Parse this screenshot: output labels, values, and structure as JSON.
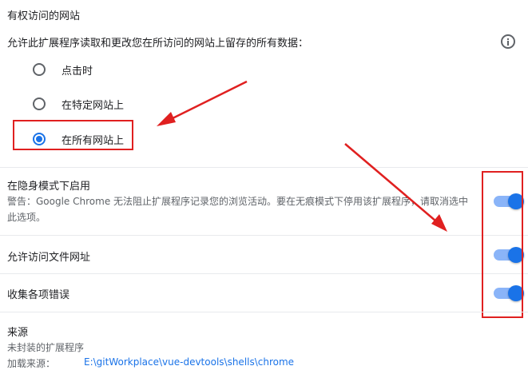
{
  "site_access": {
    "title": "有权访问的网站",
    "description": "允许此扩展程序读取和更改您在所访问的网站上留存的所有数据：",
    "options": [
      {
        "label": "点击时",
        "checked": false
      },
      {
        "label": "在特定网站上",
        "checked": false
      },
      {
        "label": "在所有网站上",
        "checked": true
      }
    ]
  },
  "incognito": {
    "title": "在隐身模式下启用",
    "warning": "警告：Google Chrome 无法阻止扩展程序记录您的浏览活动。要在无痕模式下停用该扩展程序，请取消选中此选项。",
    "enabled": true
  },
  "file_urls": {
    "title": "允许访问文件网址",
    "enabled": true
  },
  "errors": {
    "title": "收集各项错误",
    "enabled": true
  },
  "source": {
    "title": "来源",
    "type": "未封装的扩展程序",
    "path_label": "加载来源：",
    "path": "E:\\gitWorkplace\\vue-devtools\\shells\\chrome"
  },
  "colors": {
    "accent": "#1a73e8",
    "annotation": "#e02020"
  }
}
